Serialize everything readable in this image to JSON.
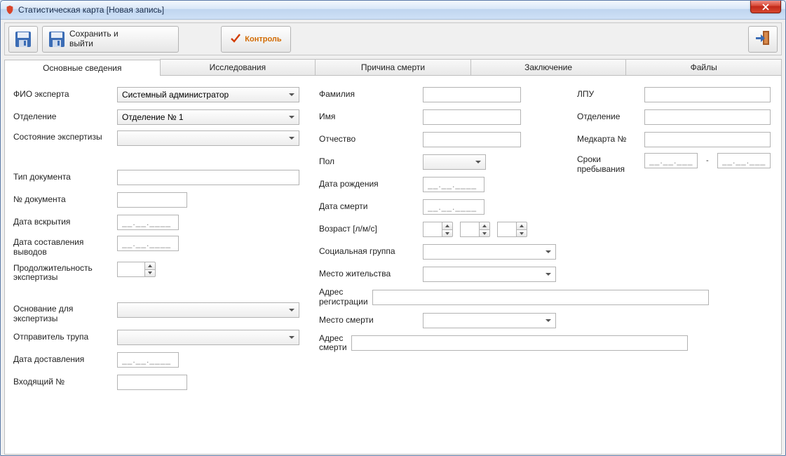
{
  "window": {
    "title": "Статистическая карта [Новая запись]"
  },
  "toolbar": {
    "save": "",
    "save_exit": "Сохранить и\nвыйти",
    "control": "Контроль"
  },
  "tabs": [
    "Основные сведения",
    "Исследования",
    "Причина смерти",
    "Заключение",
    "Файлы"
  ],
  "active_tab": 0,
  "col1": {
    "expert_label": "ФИО эксперта",
    "expert_value": "Системный администратор",
    "department_label": "Отделение",
    "department_value": "Отделение № 1",
    "status_label": "Состояние экспертизы",
    "status_value": "",
    "doc_type_label": "Тип документа",
    "doc_type_value": "",
    "doc_no_label": "№ документа",
    "doc_no_value": "",
    "autopsy_date_label": "Дата вскрытия",
    "autopsy_date_value": "__.__.____",
    "conclusion_date_label": "Дата составления выводов",
    "conclusion_date_value": "__.__.____",
    "duration_label": "Продолжительность экспертизы",
    "duration_value": "",
    "basis_label": "Основание для экспертизы",
    "basis_value": "",
    "sender_label": "Отправитель трупа",
    "sender_value": "",
    "delivery_date_label": "Дата доставления",
    "delivery_date_value": "__.__.____",
    "incoming_no_label": "Входящий №",
    "incoming_no_value": ""
  },
  "col2": {
    "surname_label": "Фамилия",
    "surname_value": "",
    "name_label": "Имя",
    "name_value": "",
    "patronymic_label": "Отчество",
    "patronymic_value": "",
    "sex_label": "Пол",
    "sex_value": "",
    "birth_label": "Дата рождения",
    "birth_value": "__.__.____",
    "death_label": "Дата смерти",
    "death_value": "__.__.____",
    "age_label": "Возраст [л/м/с]",
    "social_label": "Социальная группа",
    "social_value": "",
    "residence_label": "Место жительства",
    "residence_value": "",
    "reg_addr_label": "Адрес регистрации",
    "reg_addr_value": "",
    "death_place_label": "Место смерти",
    "death_place_value": "",
    "death_addr_label": "Адрес смерти",
    "death_addr_value": ""
  },
  "col3": {
    "lpu_label": "ЛПУ",
    "lpu_value": "",
    "dept_label": "Отделение",
    "dept_value": "",
    "card_label": "Медкарта №",
    "card_value": "",
    "stay_label": "Сроки пребывания",
    "stay_from": "__.__.____",
    "stay_to": "__.__.____",
    "dash": "-"
  }
}
